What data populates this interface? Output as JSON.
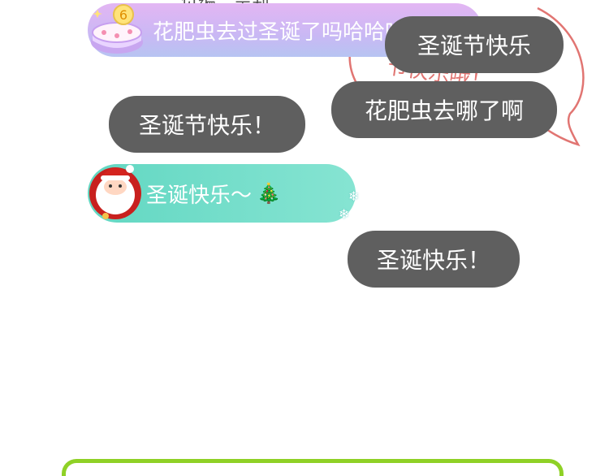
{
  "caption": "负编：吴莉",
  "doodle_lines": [
    "快",
    "节快乐哦！"
  ],
  "bubbles": {
    "b1": "花肥虫去过圣诞了吗哈哈哈",
    "b2": "圣诞节快乐",
    "b3": "花肥虫去哪了啊",
    "b4": "圣诞节快乐！",
    "b5": "圣诞快乐～",
    "b6": "圣诞快乐！"
  },
  "icons": {
    "cake": "birthday-cake-6-icon",
    "santa": "santa-claus-icon",
    "tree": "christmas-tree-icon",
    "snowflake": "snowflake-icon"
  },
  "colors": {
    "gray_bubble": "#5f5f5f",
    "purple_bubble": "#d7b8f4",
    "teal_bubble": "#6fdcc8",
    "doodle": "#d9534f",
    "bottom_border": "#8fd126"
  }
}
